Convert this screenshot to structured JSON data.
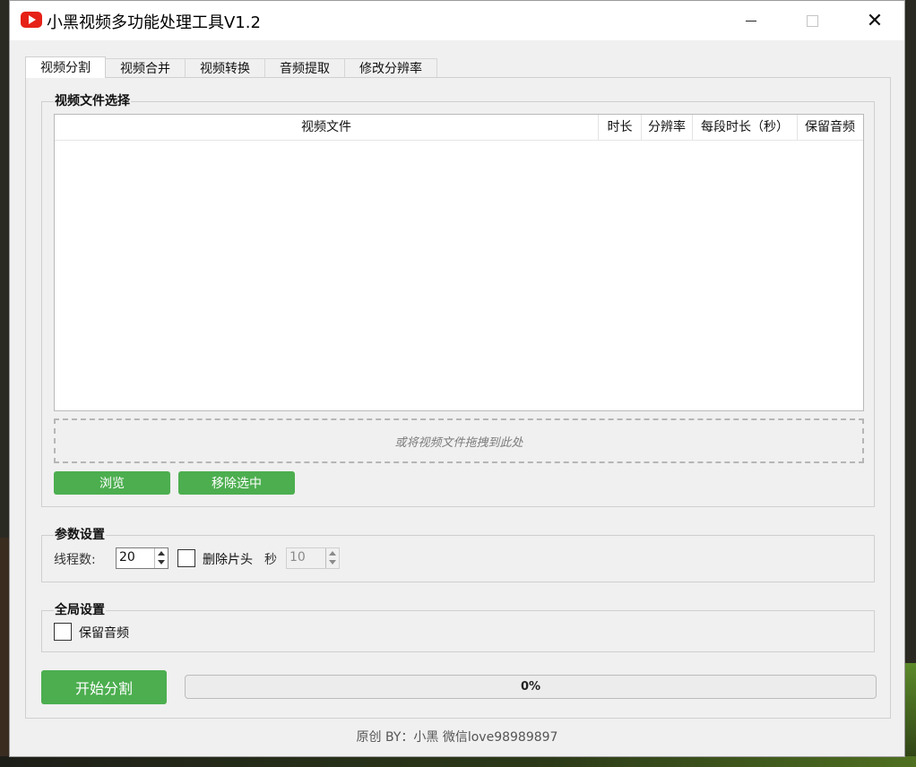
{
  "window": {
    "title": "小黑视频多功能处理工具V1.2",
    "controls": {
      "minimize": "minimize",
      "maximize": "maximize",
      "close": "✕"
    }
  },
  "tabs": [
    {
      "label": "视频分割",
      "active": true
    },
    {
      "label": "视频合并",
      "active": false
    },
    {
      "label": "视频转换",
      "active": false
    },
    {
      "label": "音频提取",
      "active": false
    },
    {
      "label": "修改分辨率",
      "active": false
    }
  ],
  "file_group": {
    "title": "视频文件选择",
    "columns": [
      "视频文件",
      "时长",
      "分辨率",
      "每段时长（秒）",
      "保留音频"
    ],
    "rows": [],
    "drop_hint": "或将视频文件拖拽到此处",
    "browse_label": "浏览",
    "remove_label": "移除选中"
  },
  "params_group": {
    "title": "参数设置",
    "threads_label": "线程数:",
    "threads_value": "20",
    "trim_label": "删除片头",
    "trim_checked": false,
    "seconds_label": "秒",
    "seconds_value": "10"
  },
  "global_group": {
    "title": "全局设置",
    "keep_audio_label": "保留音频",
    "keep_audio_checked": false
  },
  "action": {
    "start_label": "开始分割",
    "progress_percent": 0,
    "progress_text": "0%"
  },
  "footer": "原创 BY：小黑 微信love98989897",
  "colors": {
    "accent_green": "#4cae4f",
    "icon_red": "#e62117"
  }
}
